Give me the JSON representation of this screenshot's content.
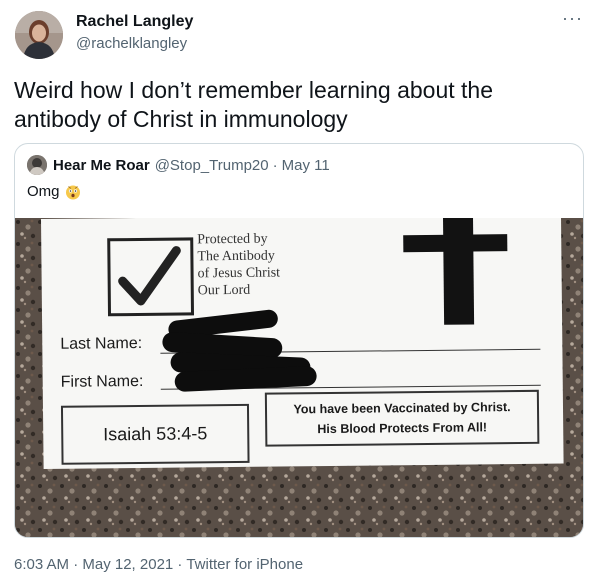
{
  "tweet": {
    "author": {
      "name": "Rachel Langley",
      "handle": "@rachelklangley"
    },
    "more_label": "···",
    "text": "Weird how I don’t remember learning about the antibody of Christ in immunology",
    "quoted": {
      "name": "Hear Me Roar",
      "handle": "@Stop_Trump20",
      "separator": "·",
      "date": "May 11",
      "text": "Omg",
      "emoji": "astonished-face-icon",
      "photo": {
        "protected_lines": [
          "Protected by",
          "The Antibody",
          "of Jesus Christ",
          "Our Lord"
        ],
        "last_name_label": "Last Name:",
        "first_name_label": "First Name:",
        "verse": "Isaiah 53:4-5",
        "message_lines": [
          "You have been Vaccinated by Christ.",
          "His Blood Protects From All!"
        ]
      }
    },
    "timestamp": "6:03 AM · May 12, 2021 · Twitter for iPhone"
  },
  "colors": {
    "text": "#0f1419",
    "secondary": "#536471",
    "border": "#cfd9de"
  }
}
